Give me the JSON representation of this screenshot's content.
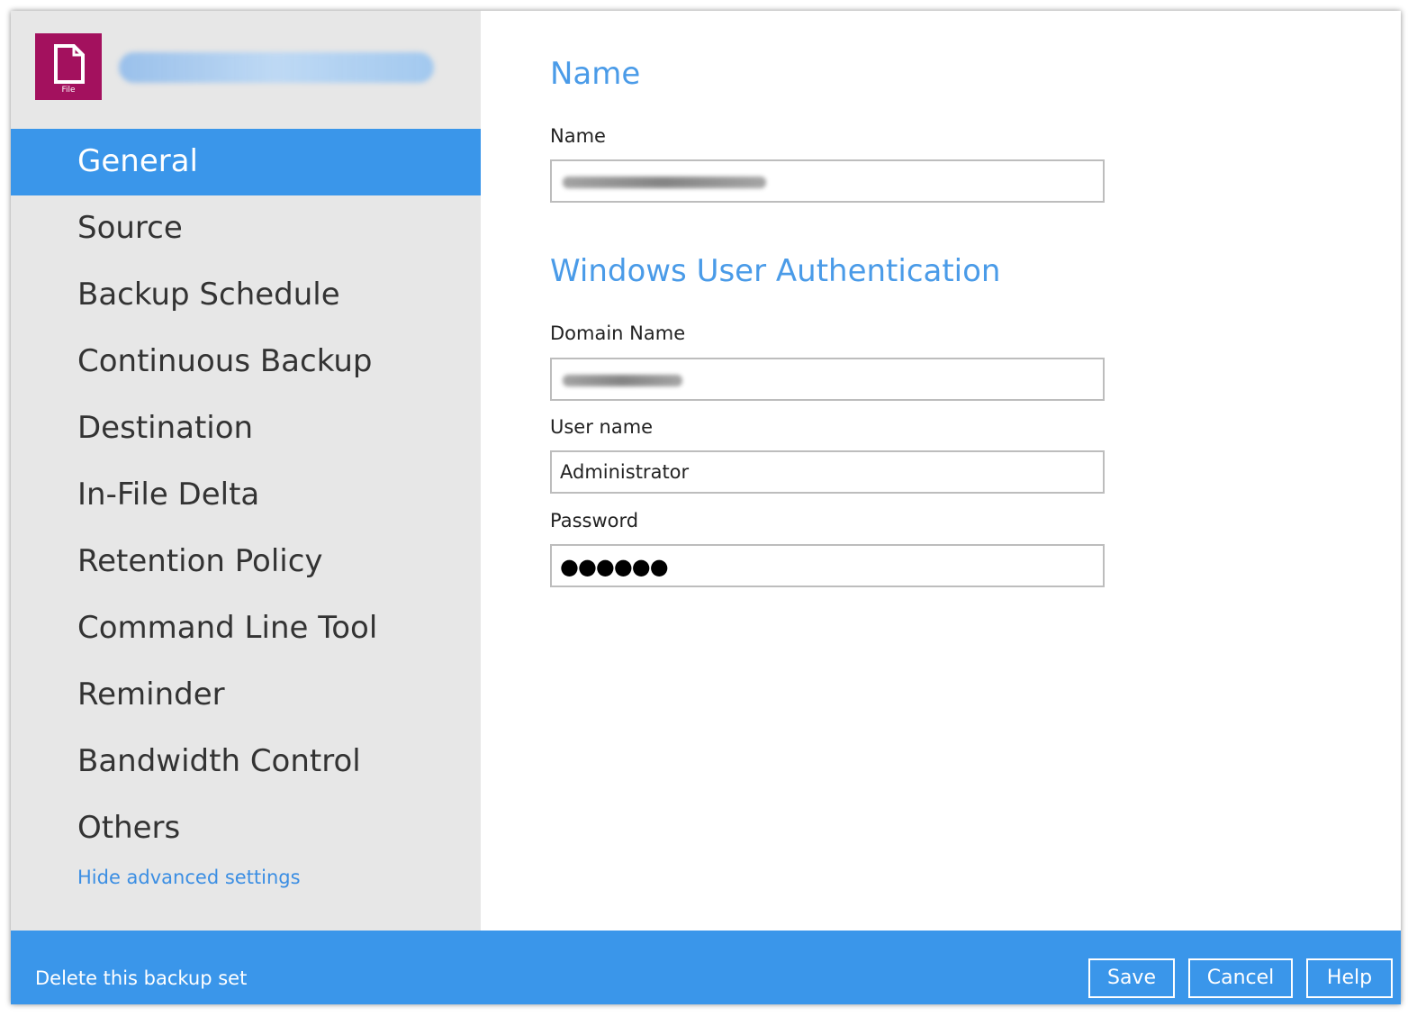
{
  "app": {
    "icon_name": "file-icon",
    "icon_caption": "File",
    "icon_color": "#a3115e",
    "accent_color": "#3a96ea"
  },
  "sidebar": {
    "items": [
      {
        "label": "General",
        "active": true
      },
      {
        "label": "Source"
      },
      {
        "label": "Backup Schedule"
      },
      {
        "label": "Continuous Backup"
      },
      {
        "label": "Destination"
      },
      {
        "label": "In-File Delta"
      },
      {
        "label": "Retention Policy"
      },
      {
        "label": "Command Line Tool"
      },
      {
        "label": "Reminder"
      },
      {
        "label": "Bandwidth Control"
      },
      {
        "label": "Others"
      }
    ],
    "hide_advanced_label": "Hide advanced settings"
  },
  "main": {
    "name_section": {
      "heading": "Name",
      "name_label": "Name",
      "name_value": ""
    },
    "auth_section": {
      "heading": "Windows User Authentication",
      "domain_label": "Domain Name",
      "domain_value": "",
      "username_label": "User name",
      "username_value": "Administrator",
      "password_label": "Password",
      "password_masked": "●●●●●●"
    }
  },
  "footer": {
    "delete_label": "Delete this backup set",
    "save_label": "Save",
    "cancel_label": "Cancel",
    "help_label": "Help"
  }
}
